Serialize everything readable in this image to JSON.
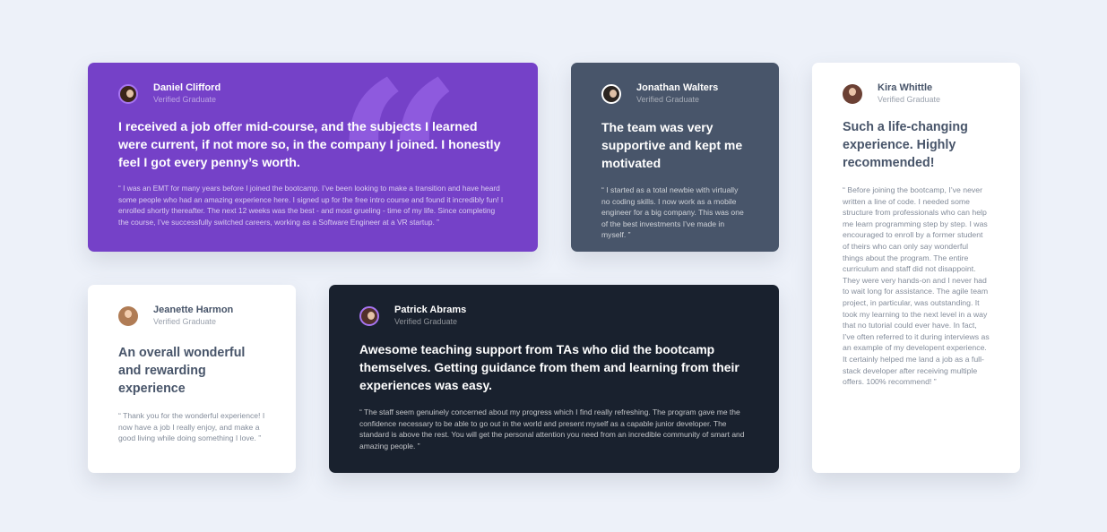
{
  "colors": {
    "background": "#edf1f9",
    "purple": "#7541c8",
    "grayish_blue": "#48556a",
    "dark_blackish_blue": "#19212e",
    "white": "#ffffff",
    "light_purple_quote": "#9763e6"
  },
  "testimonials": [
    {
      "name": "Daniel Clifford",
      "status": "Verified Graduate",
      "avatar_icon": "person-avatar",
      "headline": "I received a job offer mid-course, and the subjects I learned were current, if not more so, in the company I joined. I honestly feel I got every penny’s worth.",
      "body": "“ I was an EMT for many years before I joined the bootcamp. I’ve been looking to make a transition and have heard some people who had an amazing experience here. I signed up for the free intro course and found it incredibly fun! I enrolled shortly thereafter. The next 12 weeks was the best - and most grueling - time of my life. Since completing the course, I’ve successfully switched careers, working as a Software Engineer at a VR startup. ”",
      "background": "#7541c8"
    },
    {
      "name": "Jonathan Walters",
      "status": "Verified Graduate",
      "avatar_icon": "person-avatar",
      "headline": "The team was very supportive and kept me motivated",
      "body": "“ I started as a total newbie with virtually no coding skills. I now work as a mobile engineer for a big company. This was one of the best investments I’ve made in myself. ”",
      "background": "#48556a"
    },
    {
      "name": "Jeanette Harmon",
      "status": "Verified Graduate",
      "avatar_icon": "person-avatar",
      "headline": "An overall wonderful and rewarding experience",
      "body": "“ Thank you for the wonderful experience! I now have a job I really enjoy, and make a good living while doing something I love. ”",
      "background": "#ffffff"
    },
    {
      "name": "Patrick Abrams",
      "status": "Verified Graduate",
      "avatar_icon": "person-avatar",
      "headline": "Awesome teaching support from TAs who did the bootcamp themselves. Getting guidance from them and learning from their experiences was easy.",
      "body": "“ The staff seem genuinely concerned about my progress which I find really refreshing. The program gave me the confidence necessary to be able to go out in the world and present myself as a capable junior developer. The standard is above the rest. You will get the personal attention you need from an incredible community of smart and amazing people. ”",
      "background": "#19212e"
    },
    {
      "name": "Kira Whittle",
      "status": "Verified Graduate",
      "avatar_icon": "person-avatar",
      "headline": "Such a life-changing experience. Highly recommended!",
      "body": "“ Before joining the bootcamp, I’ve never written a line of code. I needed some structure from professionals who can help me learn programming step by step. I was encouraged to enroll by a former student of theirs who can only say wonderful things about the program. The entire curriculum and staff did not disappoint. They were very hands-on and I never had to wait long for assistance. The agile team project, in particular, was outstanding. It took my learning to the next level in a way that no tutorial could ever have. In fact, I’ve often referred to it during interviews as an example of my developent experience. It certainly helped me land a job as a full-stack developer after receiving multiple offers. 100% recommend! ”",
      "background": "#ffffff"
    }
  ]
}
